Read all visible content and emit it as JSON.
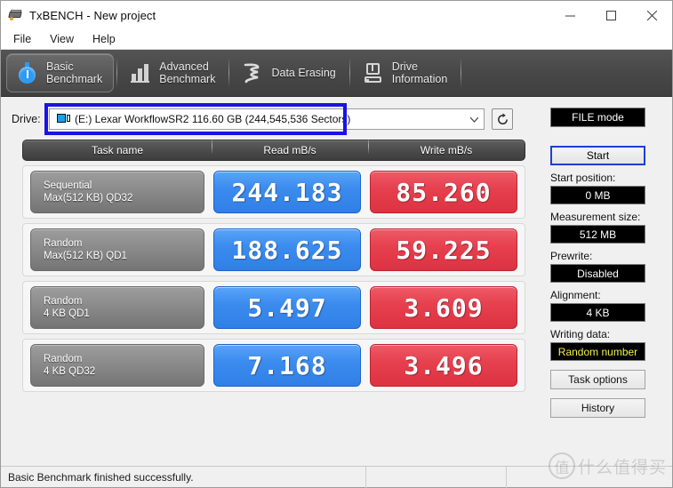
{
  "window": {
    "title": "TxBENCH - New project",
    "app_icon": "txbench-logo-icon",
    "controls": {
      "minimize": "minimize-icon",
      "maximize": "maximize-icon",
      "close": "close-icon"
    }
  },
  "menubar": {
    "items": [
      "File",
      "View",
      "Help"
    ]
  },
  "tabs": [
    {
      "label": "Basic\nBenchmark",
      "icon": "stopwatch-icon",
      "active": true
    },
    {
      "label": "Advanced\nBenchmark",
      "icon": "bar-chart-icon",
      "active": false
    },
    {
      "label": "Data Erasing",
      "icon": "shredder-icon",
      "active": false
    },
    {
      "label": "Drive\nInformation",
      "icon": "drive-info-icon",
      "active": false
    }
  ],
  "drive": {
    "label": "Drive:",
    "selected": "(E:) Lexar WorkflowSR2  116.60 GB (244,545,536 Sectors)",
    "icon": "drive-icon",
    "dropdown_arrow": "chevron-down-icon",
    "refresh_icon": "refresh-icon",
    "highlight_color": "#1a12e6"
  },
  "table": {
    "headers": [
      "Task name",
      "Read mB/s",
      "Write mB/s"
    ],
    "rows": [
      {
        "task_line1": "Sequential",
        "task_line2": "Max(512 KB) QD32",
        "read": "244.183",
        "write": "85.260"
      },
      {
        "task_line1": "Random",
        "task_line2": "Max(512 KB) QD1",
        "read": "188.625",
        "write": "59.225"
      },
      {
        "task_line1": "Random",
        "task_line2": "4 KB QD1",
        "read": "5.497",
        "write": "3.609"
      },
      {
        "task_line1": "Random",
        "task_line2": "4 KB QD32",
        "read": "7.168",
        "write": "3.496"
      }
    ],
    "read_color": "#3c8cef",
    "write_color": "#e6404e"
  },
  "panel": {
    "mode": "FILE mode",
    "start_button": "Start",
    "start_position_label": "Start position:",
    "start_position_value": "0 MB",
    "measurement_size_label": "Measurement size:",
    "measurement_size_value": "512 MB",
    "prewrite_label": "Prewrite:",
    "prewrite_value": "Disabled",
    "alignment_label": "Alignment:",
    "alignment_value": "4 KB",
    "writing_data_label": "Writing data:",
    "writing_data_value": "Random number",
    "task_options_button": "Task options",
    "history_button": "History"
  },
  "statusbar": {
    "message": "Basic Benchmark finished successfully."
  },
  "watermark": {
    "glyph": "值",
    "text": "什么值得买"
  }
}
